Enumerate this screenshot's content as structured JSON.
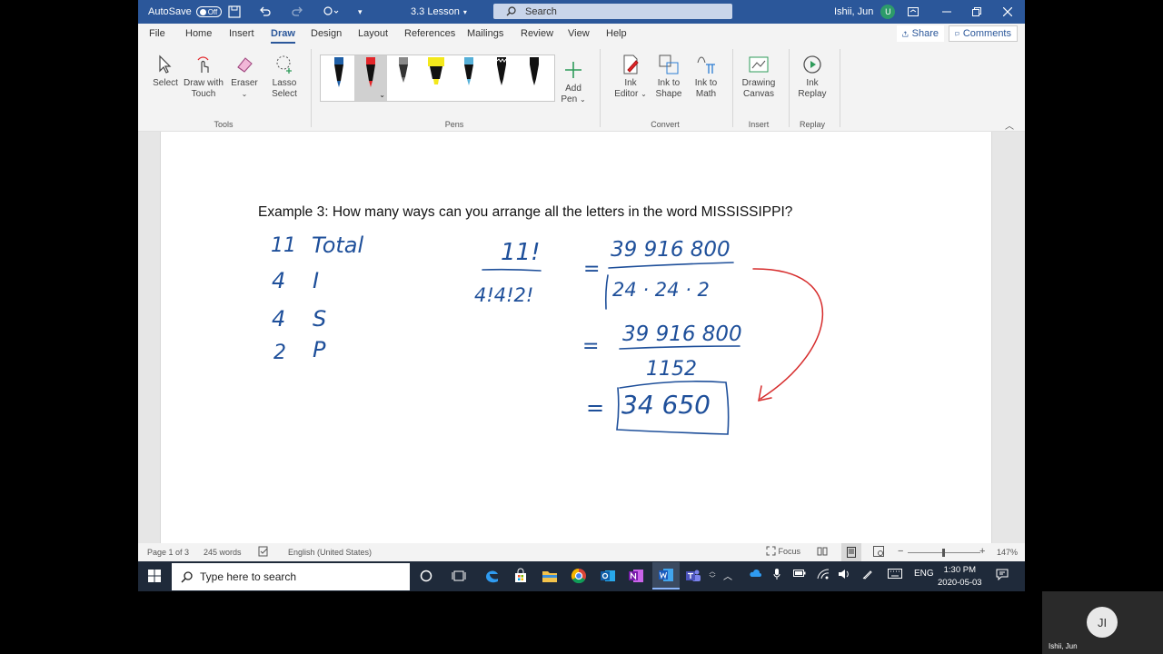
{
  "titlebar": {
    "autosave_label": "AutoSave",
    "autosave_state": "Off",
    "doc_title": "3.3 Lesson",
    "search_placeholder": "Search",
    "user_name": "Ishii, Jun",
    "user_initial": "U"
  },
  "menu": {
    "items": [
      "File",
      "Home",
      "Insert",
      "Draw",
      "Design",
      "Layout",
      "References",
      "Mailings",
      "Review",
      "View",
      "Help"
    ],
    "active": "Draw",
    "share_label": "Share",
    "comments_label": "Comments"
  },
  "ribbon": {
    "tools": {
      "select": "Select",
      "draw_touch_1": "Draw with",
      "draw_touch_2": "Touch",
      "eraser": "Eraser",
      "lasso_1": "Lasso",
      "lasso_2": "Select",
      "group": "Tools"
    },
    "pens": {
      "add_pen_1": "Add",
      "add_pen_2": "Pen",
      "group": "Pens",
      "colors": [
        "#1f5fa6",
        "#e3262a",
        "#8a8a8a",
        "#f3e81c",
        "#56b0d8",
        "#111111",
        "#111111"
      ]
    },
    "convert": {
      "ink_editor_1": "Ink",
      "ink_editor_2": "Editor",
      "ink_shape_1": "Ink to",
      "ink_shape_2": "Shape",
      "ink_math_1": "Ink to",
      "ink_math_2": "Math",
      "group": "Convert"
    },
    "insert": {
      "canvas_1": "Drawing",
      "canvas_2": "Canvas",
      "group": "Insert"
    },
    "replay": {
      "replay_1": "Ink",
      "replay_2": "Replay",
      "group": "Replay"
    }
  },
  "document": {
    "example_text": "Example 3: How many ways can you arrange all the letters in the word MISSISSIPPI?",
    "ink": {
      "total_n": "11",
      "total_label": "Total",
      "count_i": "4",
      "letter_i": "I",
      "count_s": "4",
      "letter_s": "S",
      "count_p": "2",
      "letter_p": "P",
      "numerator": "11!",
      "denominator": "4!4!2!",
      "eq1": "=",
      "step1_num": "39 916 800",
      "step1_den": "24 · 24 · 2",
      "eq2": "=",
      "step2_num": "39 916 800",
      "step2_den": "1152",
      "eq3": "=",
      "answer": "34 650",
      "ink_blue": "#1e4f9a",
      "ink_red": "#d62b2b"
    }
  },
  "status": {
    "page": "Page 1 of 3",
    "words": "245 words",
    "language": "English (United States)",
    "focus": "Focus",
    "zoom": "147%"
  },
  "taskbar": {
    "search_placeholder": "Type here to search",
    "language": "ENG",
    "time": "1:30 PM",
    "date": "2020-05-03"
  },
  "camera": {
    "initials": "JI",
    "name": "Ishii, Jun"
  }
}
